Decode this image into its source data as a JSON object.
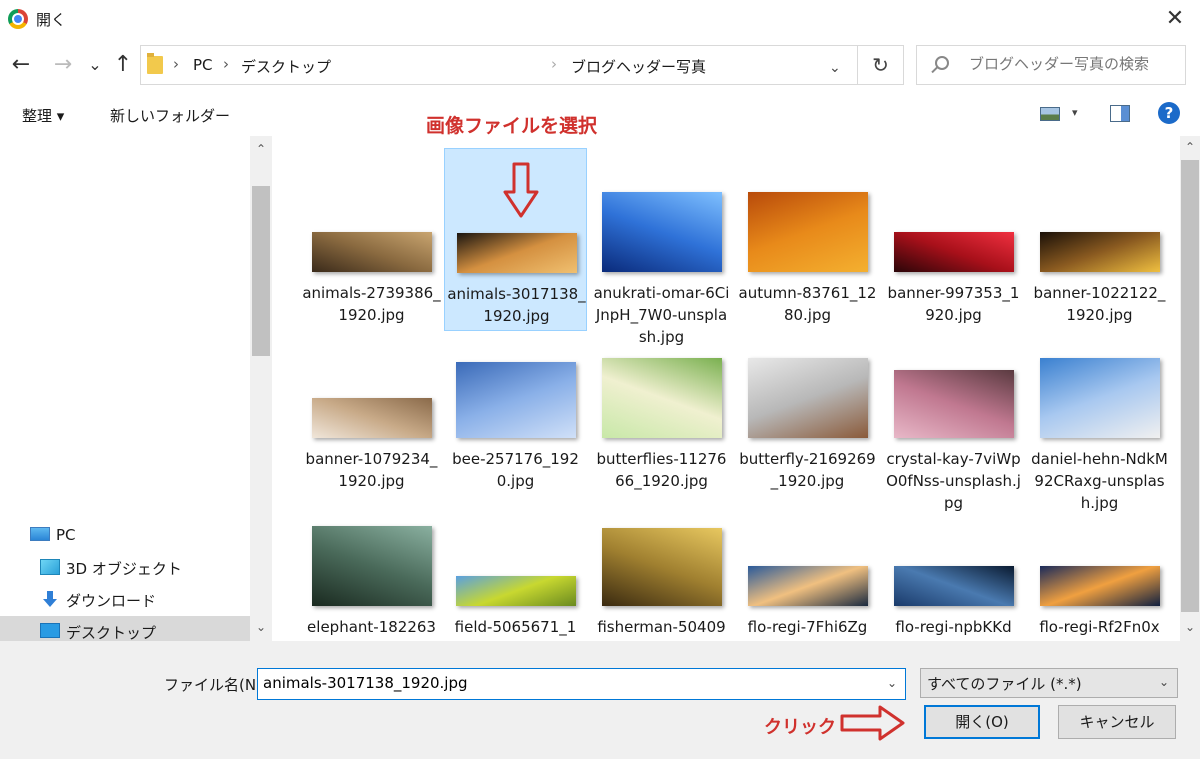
{
  "window": {
    "title": "開く",
    "close_label": "✕"
  },
  "nav": {
    "back": "←",
    "forward": "→",
    "recent": "⌄",
    "up": "↑",
    "breadcrumbs": [
      "PC",
      "デスクトップ",
      "ブログヘッダー写真"
    ],
    "crumb_sep": "›",
    "address_dropdown": "⌄",
    "refresh": "↻",
    "search_placeholder": "ブログヘッダー写真の検索"
  },
  "toolbar": {
    "organize": "整理 ▾",
    "new_folder": "新しいフォルダー",
    "annotation": "画像ファイルを選択",
    "help": "?",
    "view_dropdown": "▾"
  },
  "sidebar": {
    "scroll_up": "⌃",
    "scroll_down": "⌄",
    "items": [
      {
        "label": "PC",
        "icon": "pc-icon"
      },
      {
        "label": "3D オブジェクト",
        "icon": "cube-icon"
      },
      {
        "label": "ダウンロード",
        "icon": "download-icon"
      },
      {
        "label": "デスクトップ",
        "icon": "desktop-icon",
        "selected": true
      }
    ]
  },
  "files": [
    {
      "name": "animals-2739386_1920.jpg",
      "selected": false,
      "colors": [
        "#3a2a1a",
        "#8a6a40",
        "#c9a570"
      ]
    },
    {
      "name": "animals-3017138_1920.jpg",
      "selected": true,
      "colors": [
        "#1a1510",
        "#d49040",
        "#f0c070"
      ]
    },
    {
      "name": "anukrati-omar-6CiJnpH_7W0-unsplash.jpg",
      "selected": false,
      "colors": [
        "#0a2a7a",
        "#2f72d8",
        "#7fc0ff"
      ]
    },
    {
      "name": "autumn-83761_1280.jpg",
      "selected": false,
      "colors": [
        "#b84a0a",
        "#e88a1a",
        "#f4b030"
      ]
    },
    {
      "name": "banner-997353_1920.jpg",
      "selected": false,
      "colors": [
        "#2a0508",
        "#a8101a",
        "#f03040"
      ]
    },
    {
      "name": "banner-1022122_1920.jpg",
      "selected": false,
      "colors": [
        "#1a1008",
        "#8a5a20",
        "#f0c040"
      ]
    },
    {
      "name": "banner-1079234_1920.jpg",
      "selected": false,
      "colors": [
        "#f0e6da",
        "#c8aa88",
        "#8a6a4a"
      ]
    },
    {
      "name": "bee-257176_1920.jpg",
      "selected": false,
      "colors": [
        "#3a6ab8",
        "#8ab0e8",
        "#d0e0f8"
      ]
    },
    {
      "name": "butterflies-1127666_1920.jpg",
      "selected": false,
      "colors": [
        "#c8e8a8",
        "#f0f0d0",
        "#7ab050"
      ]
    },
    {
      "name": "butterfly-2169269_1920.jpg",
      "selected": false,
      "colors": [
        "#e8e8e8",
        "#b8b8b8",
        "#8a5a3a"
      ]
    },
    {
      "name": "crystal-kay-7viWpO0fNss-unsplash.jpg",
      "selected": false,
      "colors": [
        "#e8b8c8",
        "#c07890",
        "#5a3a40"
      ]
    },
    {
      "name": "daniel-hehn-NdkM92CRaxg-unsplash.jpg",
      "selected": false,
      "colors": [
        "#3a80d0",
        "#a8c8f0",
        "#f0f0f0"
      ]
    },
    {
      "name": "elephant-182263",
      "selected": false,
      "colors": [
        "#1a2a20",
        "#4a6a5a",
        "#8ab0a0"
      ]
    },
    {
      "name": "field-5065671_1",
      "selected": false,
      "colors": [
        "#5aa0e0",
        "#c8d830",
        "#6a8a20"
      ]
    },
    {
      "name": "fisherman-50409",
      "selected": false,
      "colors": [
        "#3a2a10",
        "#a08030",
        "#e8c860"
      ]
    },
    {
      "name": "flo-regi-7Fhi6Zg",
      "selected": false,
      "colors": [
        "#2a5a9a",
        "#f0c080",
        "#1a2a40"
      ]
    },
    {
      "name": "flo-regi-npbKKd",
      "selected": false,
      "colors": [
        "#1a3a6a",
        "#4a7ab0",
        "#0a1a30"
      ]
    },
    {
      "name": "flo-regi-Rf2Fn0x",
      "selected": false,
      "colors": [
        "#1a2a5a",
        "#f0a040",
        "#102040"
      ]
    }
  ],
  "bottom": {
    "filename_label": "ファイル名(N):",
    "filename_value": "animals-3017138_1920.jpg",
    "filetype": "すべてのファイル (*.*)",
    "dropdown": "⌄",
    "annotation": "クリック",
    "open": "開く(O)",
    "cancel": "キャンセル"
  },
  "colors": {
    "accent": "#0078d7",
    "annotation": "#d0312d",
    "selection": "#cce8ff"
  }
}
